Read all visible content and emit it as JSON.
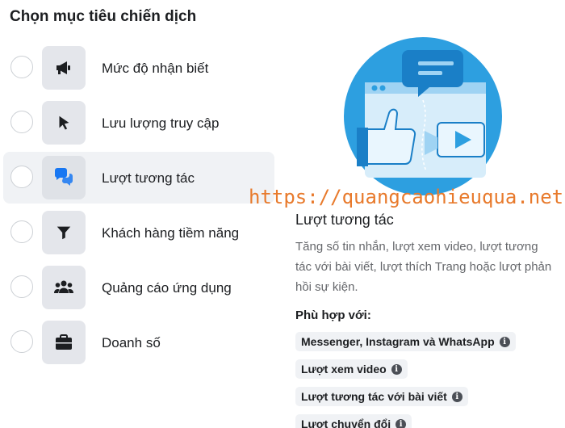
{
  "title": "Chọn mục tiêu chiến dịch",
  "options": [
    {
      "label": "Mức độ nhận biết",
      "icon": "megaphone-icon",
      "selected": false
    },
    {
      "label": "Lưu lượng truy cập",
      "icon": "cursor-icon",
      "selected": false
    },
    {
      "label": "Lượt tương tác",
      "icon": "chat-bubbles-icon",
      "selected": true
    },
    {
      "label": "Khách hàng tiềm năng",
      "icon": "filter-icon",
      "selected": false
    },
    {
      "label": "Quảng cáo ứng dụng",
      "icon": "people-icon",
      "selected": false
    },
    {
      "label": "Doanh số",
      "icon": "briefcase-icon",
      "selected": false
    }
  ],
  "watermark": "https://quangcaohieuqua.net",
  "detail": {
    "title": "Lượt tương tác",
    "description": "Tăng số tin nhắn, lượt xem video, lượt tương tác với bài viết, lượt thích Trang hoặc lượt phản hồi sự kiện.",
    "fit_label": "Phù hợp với:",
    "chips": [
      "Messenger, Instagram và WhatsApp",
      "Lượt xem video",
      "Lượt tương tác với bài viết",
      "Lượt chuyển đổi"
    ]
  },
  "colors": {
    "accent_blue": "#1877f2",
    "illustration_blue": "#2d9fe0",
    "watermark_orange": "#e87a2c"
  }
}
